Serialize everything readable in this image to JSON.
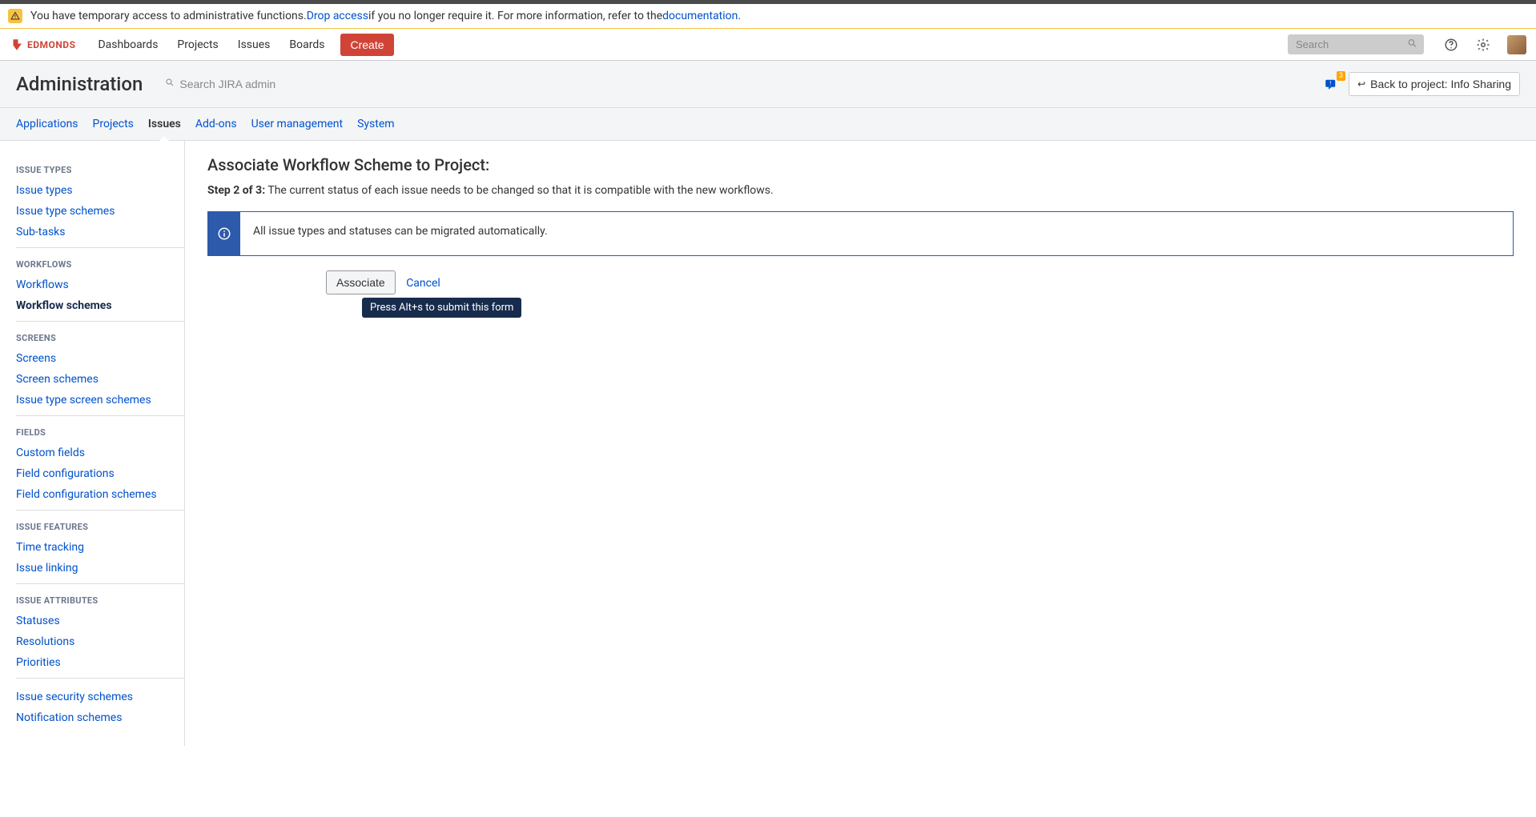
{
  "banner": {
    "text_pre": "You have temporary access to administrative functions. ",
    "link_drop": "Drop access",
    "text_mid": " if you no longer require it. For more information, refer to the ",
    "link_doc": "documentation",
    "text_post": "."
  },
  "nav": {
    "items": [
      "Dashboards",
      "Projects",
      "Issues",
      "Boards"
    ],
    "create": "Create",
    "search_placeholder": "Search",
    "logo_text": "EDMONDS"
  },
  "admin_header": {
    "title": "Administration",
    "search_placeholder": "Search JIRA admin",
    "feedback_badge": "3",
    "back_label": "Back to project: Info Sharing"
  },
  "admin_tabs": [
    "Applications",
    "Projects",
    "Issues",
    "Add-ons",
    "User management",
    "System"
  ],
  "admin_tabs_active_index": 2,
  "sidebar": {
    "sections": [
      {
        "heading": "ISSUE TYPES",
        "items": [
          "Issue types",
          "Issue type schemes",
          "Sub-tasks"
        ],
        "active_index": -1
      },
      {
        "heading": "WORKFLOWS",
        "items": [
          "Workflows",
          "Workflow schemes"
        ],
        "active_index": 1
      },
      {
        "heading": "SCREENS",
        "items": [
          "Screens",
          "Screen schemes",
          "Issue type screen schemes"
        ],
        "active_index": -1
      },
      {
        "heading": "FIELDS",
        "items": [
          "Custom fields",
          "Field configurations",
          "Field configuration schemes"
        ],
        "active_index": -1
      },
      {
        "heading": "ISSUE FEATURES",
        "items": [
          "Time tracking",
          "Issue linking"
        ],
        "active_index": -1
      },
      {
        "heading": "ISSUE ATTRIBUTES",
        "items": [
          "Statuses",
          "Resolutions",
          "Priorities"
        ],
        "active_index": -1
      },
      {
        "heading": "",
        "items": [
          "Issue security schemes",
          "Notification schemes"
        ],
        "active_index": -1
      }
    ]
  },
  "content": {
    "heading": "Associate Workflow Scheme to Project:",
    "step_bold": "Step 2 of 3:",
    "step_rest": " The current status of each issue needs to be changed so that it is compatible with the new workflows.",
    "info_msg": "All issue types and statuses can be migrated automatically.",
    "associate_btn": "Associate",
    "cancel": "Cancel",
    "tooltip": "Press Alt+s to submit this form"
  }
}
